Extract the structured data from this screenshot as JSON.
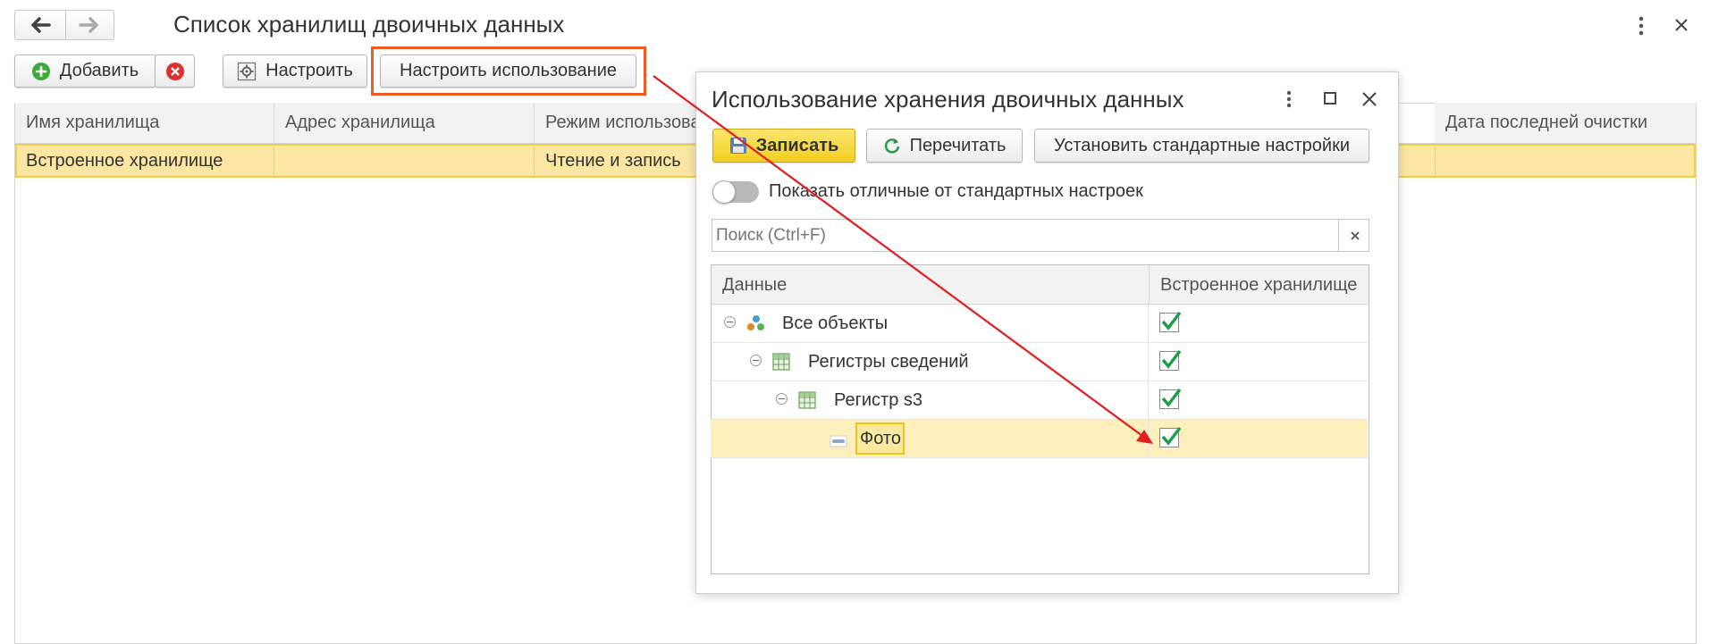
{
  "main": {
    "title": "Список хранилищ двоичных данных",
    "toolbar": {
      "add_label": "Добавить",
      "configure_label": "Настроить",
      "configure_usage_label": "Настроить использование"
    },
    "columns": [
      "Имя хранилища",
      "Адрес хранилища",
      "Режим использова",
      "Дата последней очистки"
    ],
    "rows": [
      {
        "name": "Встроенное хранилище",
        "address": "",
        "mode": "Чтение и запись",
        "last_cleanup": ""
      }
    ]
  },
  "dialog": {
    "title": "Использование хранения двоичных данных",
    "buttons": {
      "save": "Записать",
      "reread": "Перечитать",
      "defaults": "Установить стандартные настройки"
    },
    "toggle_label": "Показать отличные от стандартных настроек",
    "toggle_on": false,
    "search_placeholder": "Поиск (Ctrl+F)",
    "search_value": "",
    "columns": [
      "Данные",
      "Встроенное хранилище"
    ],
    "tree": [
      {
        "label": "Все объекты",
        "level": 0,
        "icon": "objects-icon",
        "checked": true
      },
      {
        "label": "Регистры сведений",
        "level": 1,
        "icon": "register-icon",
        "checked": true
      },
      {
        "label": "Регистр s3",
        "level": 2,
        "icon": "register-icon",
        "checked": true
      },
      {
        "label": "Фото",
        "level": 3,
        "icon": "attribute-icon",
        "checked": true,
        "selected": true
      }
    ]
  },
  "colors": {
    "accent_yellow": "#f9e07a",
    "selection_row": "#fdf0bd",
    "highlight_border": "#f05a24",
    "arrow": "#e11d1d",
    "check_green": "#1a9e46"
  }
}
